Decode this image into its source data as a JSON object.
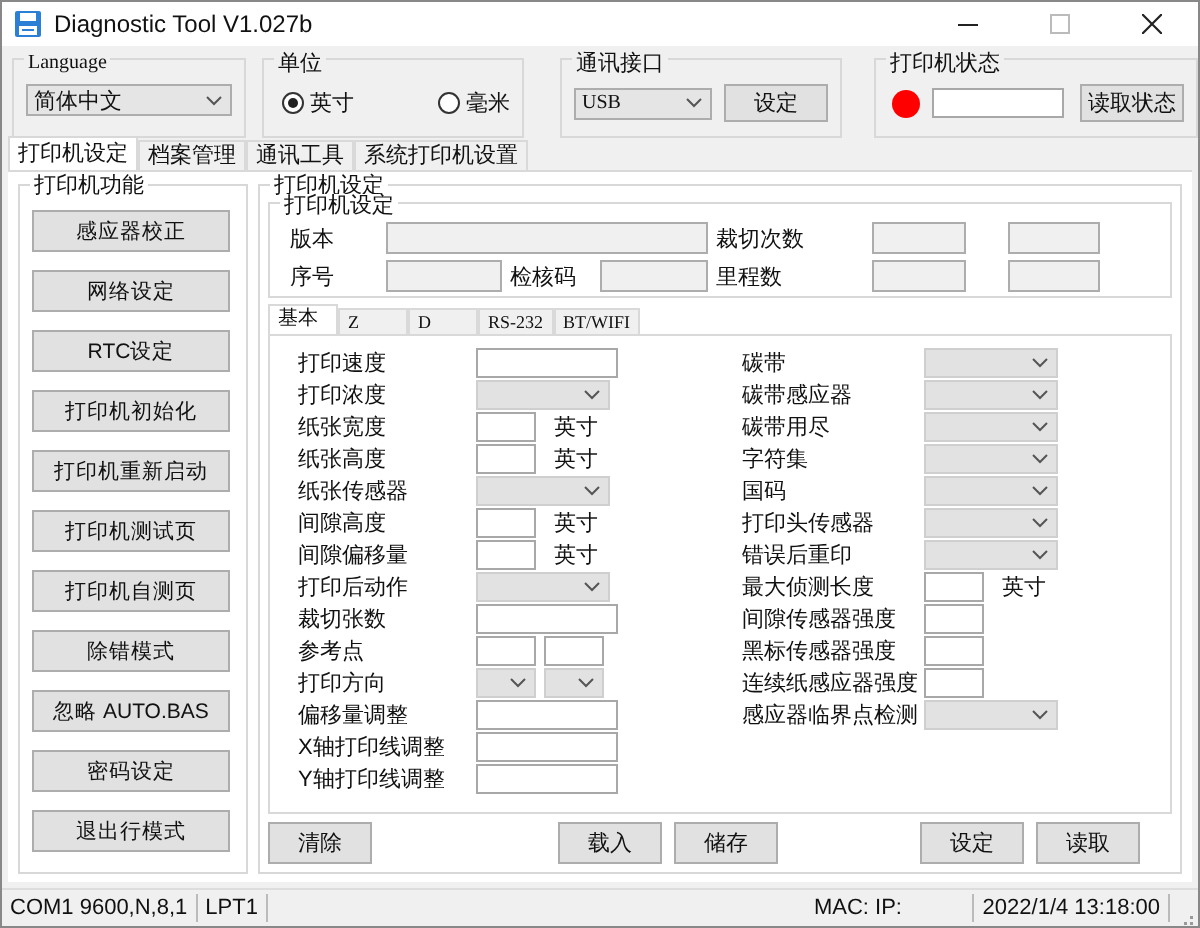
{
  "window": {
    "title": "Diagnostic Tool V1.027b"
  },
  "language": {
    "label": "Language",
    "value": "简体中文"
  },
  "unit": {
    "label": "单位",
    "options": [
      {
        "label": "英寸",
        "selected": true
      },
      {
        "label": "毫米",
        "selected": false
      }
    ]
  },
  "port": {
    "label": "通讯接口",
    "value": "USB",
    "button": "设定"
  },
  "printer_status": {
    "label": "打印机状态",
    "color": "#ff0000",
    "button": "读取状态"
  },
  "tabs": [
    {
      "label": "打印机设定",
      "selected": true
    },
    {
      "label": "档案管理",
      "selected": false
    },
    {
      "label": "通讯工具",
      "selected": false
    },
    {
      "label": "系统打印机设置",
      "selected": false
    }
  ],
  "functions": {
    "title": "打印机功能",
    "buttons": [
      "感应器校正",
      "网络设定",
      "RTC设定",
      "打印机初始化",
      "打印机重新启动",
      "打印机测试页",
      "打印机自测页",
      "除错模式",
      "忽略 AUTO.BAS",
      "密码设定",
      "退出行模式"
    ]
  },
  "settings": {
    "title": "打印机设定",
    "info": {
      "title": "打印机设定",
      "fields": [
        {
          "label": "版本",
          "kind": "wide"
        },
        {
          "label": "裁切次数",
          "kind": "double"
        },
        {
          "label": "序号",
          "kind": "single"
        },
        {
          "label": "检核码",
          "kind": "single"
        },
        {
          "label": "里程数",
          "kind": "double"
        }
      ]
    },
    "tabs": [
      {
        "label": "基本",
        "selected": true
      },
      {
        "label": "Z",
        "selected": false
      },
      {
        "label": "D",
        "selected": false
      },
      {
        "label": "RS-232",
        "selected": false
      },
      {
        "label": "BT/WIFI",
        "selected": false
      }
    ],
    "left_rows": [
      {
        "label": "打印速度",
        "kind": "text"
      },
      {
        "label": "打印浓度",
        "kind": "combo"
      },
      {
        "label": "纸张宽度",
        "kind": "short",
        "unit": "英寸"
      },
      {
        "label": "纸张高度",
        "kind": "short",
        "unit": "英寸"
      },
      {
        "label": "纸张传感器",
        "kind": "combo"
      },
      {
        "label": "间隙高度",
        "kind": "short",
        "unit": "英寸"
      },
      {
        "label": "间隙偏移量",
        "kind": "short",
        "unit": "英寸"
      },
      {
        "label": "打印后动作",
        "kind": "combo"
      },
      {
        "label": "裁切张数",
        "kind": "text"
      },
      {
        "label": "参考点",
        "kind": "pair_text"
      },
      {
        "label": "打印方向",
        "kind": "pair_combo"
      },
      {
        "label": "偏移量调整",
        "kind": "text"
      },
      {
        "label": "X轴打印线调整",
        "kind": "text"
      },
      {
        "label": "Y轴打印线调整",
        "kind": "text"
      }
    ],
    "right_rows": [
      {
        "label": "碳带",
        "kind": "combo"
      },
      {
        "label": "碳带感应器",
        "kind": "combo"
      },
      {
        "label": "碳带用尽",
        "kind": "combo"
      },
      {
        "label": "字符集",
        "kind": "combo"
      },
      {
        "label": "国码",
        "kind": "combo"
      },
      {
        "label": "打印头传感器",
        "kind": "combo"
      },
      {
        "label": "错误后重印",
        "kind": "combo"
      },
      {
        "label": "最大侦测长度",
        "kind": "short",
        "unit": "英寸"
      },
      {
        "label": "间隙传感器强度",
        "kind": "short"
      },
      {
        "label": "黑标传感器强度",
        "kind": "short"
      },
      {
        "label": "连续纸感应器强度",
        "kind": "short"
      },
      {
        "label": "感应器临界点检测",
        "kind": "combo"
      }
    ],
    "actions": {
      "left": [
        "清除"
      ],
      "middle": [
        "载入",
        "储存"
      ],
      "right": [
        "设定",
        "读取"
      ]
    }
  },
  "status_bar": [
    {
      "text": "COM1 9600,N,8,1"
    },
    {
      "text": "LPT1"
    },
    {
      "text": "MAC: IP:"
    },
    {
      "text": "2022/1/4 13:18:00"
    }
  ]
}
